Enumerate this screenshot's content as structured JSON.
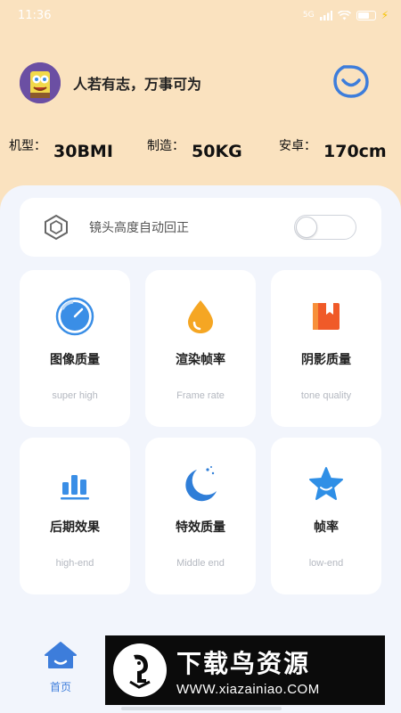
{
  "status_bar": {
    "time": "11:36",
    "signal_text": "5G"
  },
  "profile": {
    "motto": "人若有志，万事可为"
  },
  "stats": [
    {
      "label": "机型：",
      "value": "30BMI"
    },
    {
      "label": "制造：",
      "value": "50KG"
    },
    {
      "label": "安卓：",
      "value": "170cm"
    }
  ],
  "auto_correct": {
    "label": "镜头高度自动回正",
    "enabled": false
  },
  "tiles": [
    {
      "title": "图像质量",
      "subtitle": "super high",
      "icon": "gauge-icon",
      "color": "#3a8ee6"
    },
    {
      "title": "渲染帧率",
      "subtitle": "Frame rate",
      "icon": "droplet-icon",
      "color": "#f5a623"
    },
    {
      "title": "阴影质量",
      "subtitle": "tone quality",
      "icon": "bookmark-icon",
      "color": "#f05a28"
    },
    {
      "title": "后期效果",
      "subtitle": "high-end",
      "icon": "bar-chart-icon",
      "color": "#3a8ee6"
    },
    {
      "title": "特效质量",
      "subtitle": "Middle end",
      "icon": "moon-icon",
      "color": "#2f7ed8"
    },
    {
      "title": "帧率",
      "subtitle": "low-end",
      "icon": "star-icon",
      "color": "#2f8fe6"
    }
  ],
  "nav": {
    "home_label": "首页"
  },
  "watermark": {
    "title": "下载鸟资源",
    "url": "WWW.xiazainiao.COM"
  },
  "colors": {
    "header_bg": "#fae2bf",
    "panel_bg": "#f2f5fc",
    "accent": "#3d7ddb"
  }
}
